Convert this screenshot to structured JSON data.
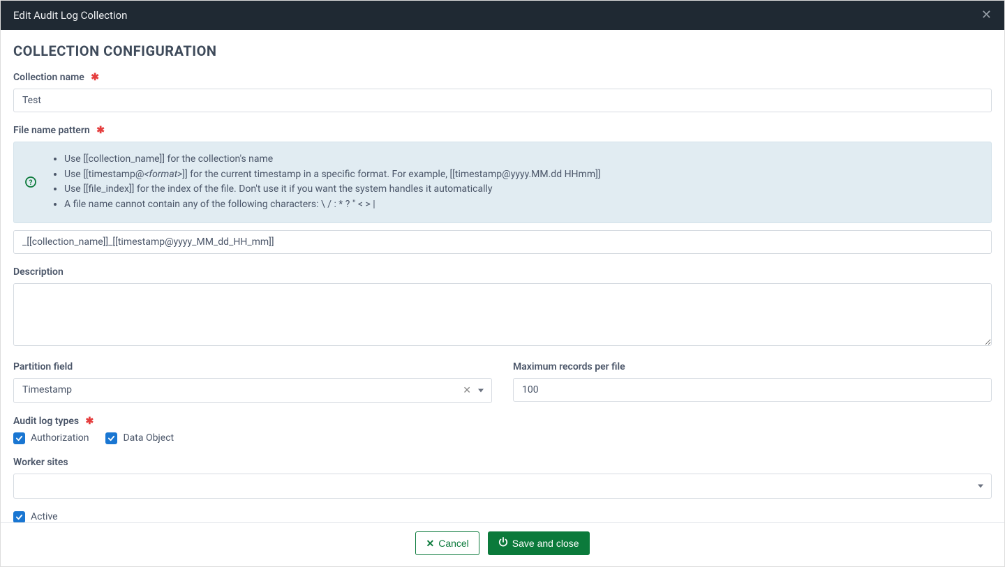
{
  "header": {
    "title": "Edit Audit Log Collection"
  },
  "section_title": "COLLECTION CONFIGURATION",
  "fields": {
    "collection_name": {
      "label": "Collection name",
      "value": "Test"
    },
    "file_name_pattern": {
      "label": "File name pattern",
      "value": "_[[collection_name]]_[[timestamp@yyyy_MM_dd_HH_mm]]"
    },
    "description": {
      "label": "Description",
      "value": ""
    },
    "partition_field": {
      "label": "Partition field",
      "value": "Timestamp"
    },
    "max_records": {
      "label": "Maximum records per file",
      "value": "100"
    },
    "audit_log_types": {
      "label": "Audit log types"
    },
    "worker_sites": {
      "label": "Worker sites",
      "value": ""
    },
    "active": {
      "label": "Active"
    }
  },
  "help": {
    "items": [
      "Use [[collection_name]] for the collection's name",
      "Use [[timestamp@<format>]] for the current timestamp in a specific format. For example, [[timestamp@yyyy.MM.dd HHmm]]",
      "Use [[file_index]] for the index of the file. Don't use it if you want the system handles it automatically",
      "A file name cannot contain any of the following characters: \\ / : * ? \" < > |"
    ]
  },
  "checkboxes": {
    "authorization": "Authorization",
    "data_object": "Data Object"
  },
  "buttons": {
    "cancel": "Cancel",
    "save": "Save and close"
  }
}
